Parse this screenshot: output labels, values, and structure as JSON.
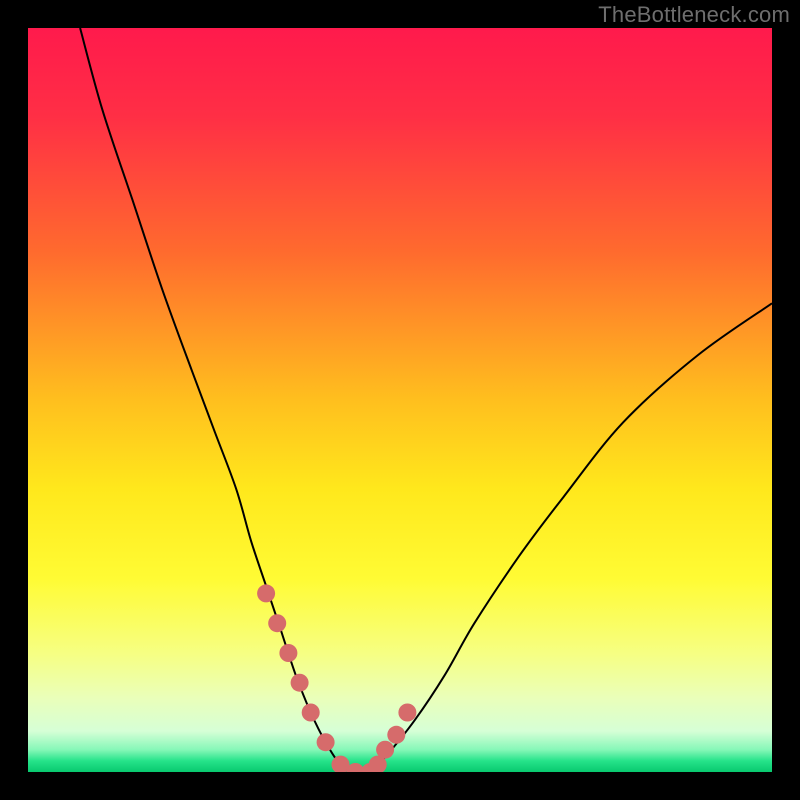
{
  "watermark": "TheBottleneck.com",
  "colors": {
    "bg_black": "#000000",
    "curve": "#000000",
    "marker": "#d66b6b",
    "gradient_stops": [
      {
        "pos": 0.0,
        "color": "#ff1a4c"
      },
      {
        "pos": 0.12,
        "color": "#ff2f45"
      },
      {
        "pos": 0.3,
        "color": "#ff6a2e"
      },
      {
        "pos": 0.5,
        "color": "#ffbf1e"
      },
      {
        "pos": 0.62,
        "color": "#ffe81c"
      },
      {
        "pos": 0.74,
        "color": "#fffb34"
      },
      {
        "pos": 0.84,
        "color": "#f6ff82"
      },
      {
        "pos": 0.9,
        "color": "#eaffb9"
      },
      {
        "pos": 0.945,
        "color": "#d6ffd6"
      },
      {
        "pos": 0.97,
        "color": "#86f7b8"
      },
      {
        "pos": 0.985,
        "color": "#26e38a"
      },
      {
        "pos": 1.0,
        "color": "#08c96f"
      }
    ]
  },
  "chart_data": {
    "type": "line",
    "title": "",
    "xlabel": "",
    "ylabel": "",
    "xlim": [
      0,
      100
    ],
    "ylim": [
      0,
      100
    ],
    "series": [
      {
        "name": "bottleneck-curve",
        "x": [
          7,
          10,
          14,
          18,
          22,
          25,
          28,
          30,
          32,
          34,
          36,
          38,
          40,
          42,
          44,
          46,
          48,
          52,
          56,
          60,
          66,
          72,
          80,
          90,
          100
        ],
        "y": [
          100,
          89,
          77,
          65,
          54,
          46,
          38,
          31,
          25,
          19,
          13,
          8,
          4,
          1,
          0,
          0,
          2,
          7,
          13,
          20,
          29,
          37,
          47,
          56,
          63
        ]
      }
    ],
    "markers": {
      "name": "highlighted-points",
      "x": [
        32,
        33.5,
        35,
        36.5,
        38,
        40,
        42,
        44,
        46,
        47,
        48,
        49.5,
        51
      ],
      "y": [
        24,
        20,
        16,
        12,
        8,
        4,
        1,
        0,
        0,
        1,
        3,
        5,
        8
      ]
    }
  }
}
